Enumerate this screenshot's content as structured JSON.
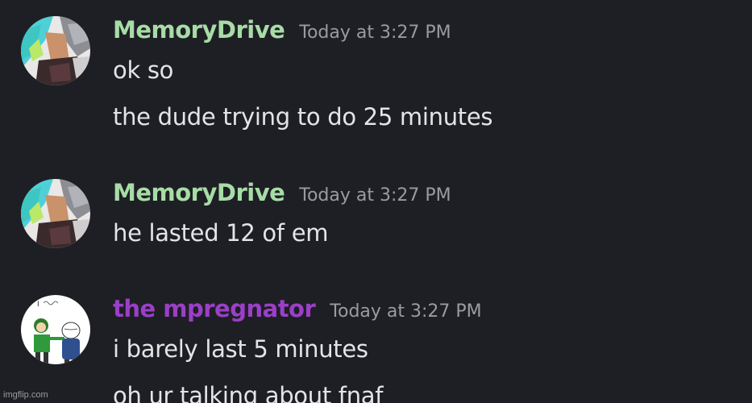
{
  "messages": [
    {
      "author": "MemoryDrive",
      "author_color": "#a8dca7",
      "timestamp": "Today at 3:27 PM",
      "avatar": "memorydrive-avatar",
      "lines": [
        "ok so",
        "the dude trying to do 25 minutes"
      ]
    },
    {
      "author": "MemoryDrive",
      "author_color": "#a8dca7",
      "timestamp": "Today at 3:27 PM",
      "avatar": "memorydrive-avatar",
      "lines": [
        "he lasted 12 of em"
      ]
    },
    {
      "author": "the mpregnator",
      "author_color": "#9b3fc8",
      "timestamp": "Today at 3:27 PM",
      "avatar": "mpregnator-avatar",
      "lines": [
        "i barely last 5 minutes",
        "oh ur talking about fnaf"
      ]
    }
  ],
  "watermark": "imgflip.com"
}
